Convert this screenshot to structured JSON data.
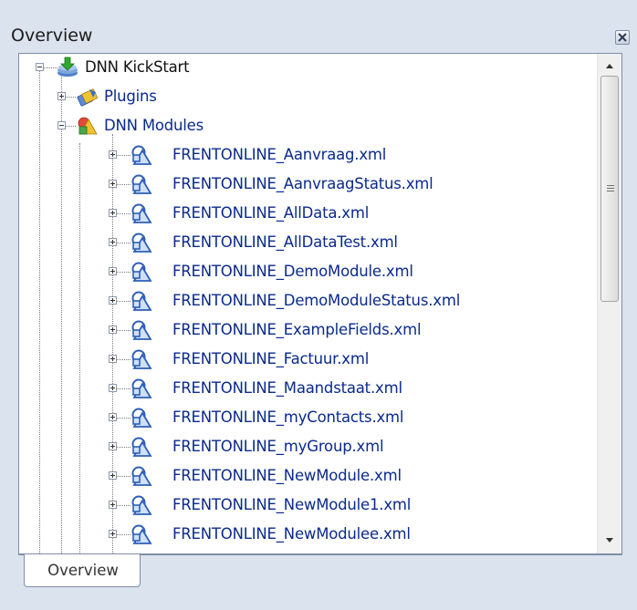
{
  "panel": {
    "title": "Overview",
    "close_icon": "close-icon"
  },
  "tree": {
    "root": {
      "label": "DNN KickStart",
      "icon": "package-download-icon",
      "expanded": true
    },
    "children": [
      {
        "label": "Plugins",
        "icon": "plugins-icon",
        "expanded": false
      },
      {
        "label": "DNN Modules",
        "icon": "modules-icon",
        "expanded": true
      }
    ],
    "modules": [
      "FRENTONLINE_Aanvraag.xml",
      "FRENTONLINE_AanvraagStatus.xml",
      "FRENTONLINE_AllData.xml",
      "FRENTONLINE_AllDataTest.xml",
      "FRENTONLINE_DemoModule.xml",
      "FRENTONLINE_DemoModuleStatus.xml",
      "FRENTONLINE_ExampleFields.xml",
      "FRENTONLINE_Factuur.xml",
      "FRENTONLINE_Maandstaat.xml",
      "FRENTONLINE_myContacts.xml",
      "FRENTONLINE_myGroup.xml",
      "FRENTONLINE_NewModule.xml",
      "FRENTONLINE_NewModule1.xml",
      "FRENTONLINE_NewModulee.xml"
    ]
  },
  "tabs": [
    {
      "label": "Overview",
      "active": true
    }
  ],
  "colors": {
    "link": "#0a2a8c",
    "background": "#dbe3ee",
    "border": "#7e8ea6"
  }
}
